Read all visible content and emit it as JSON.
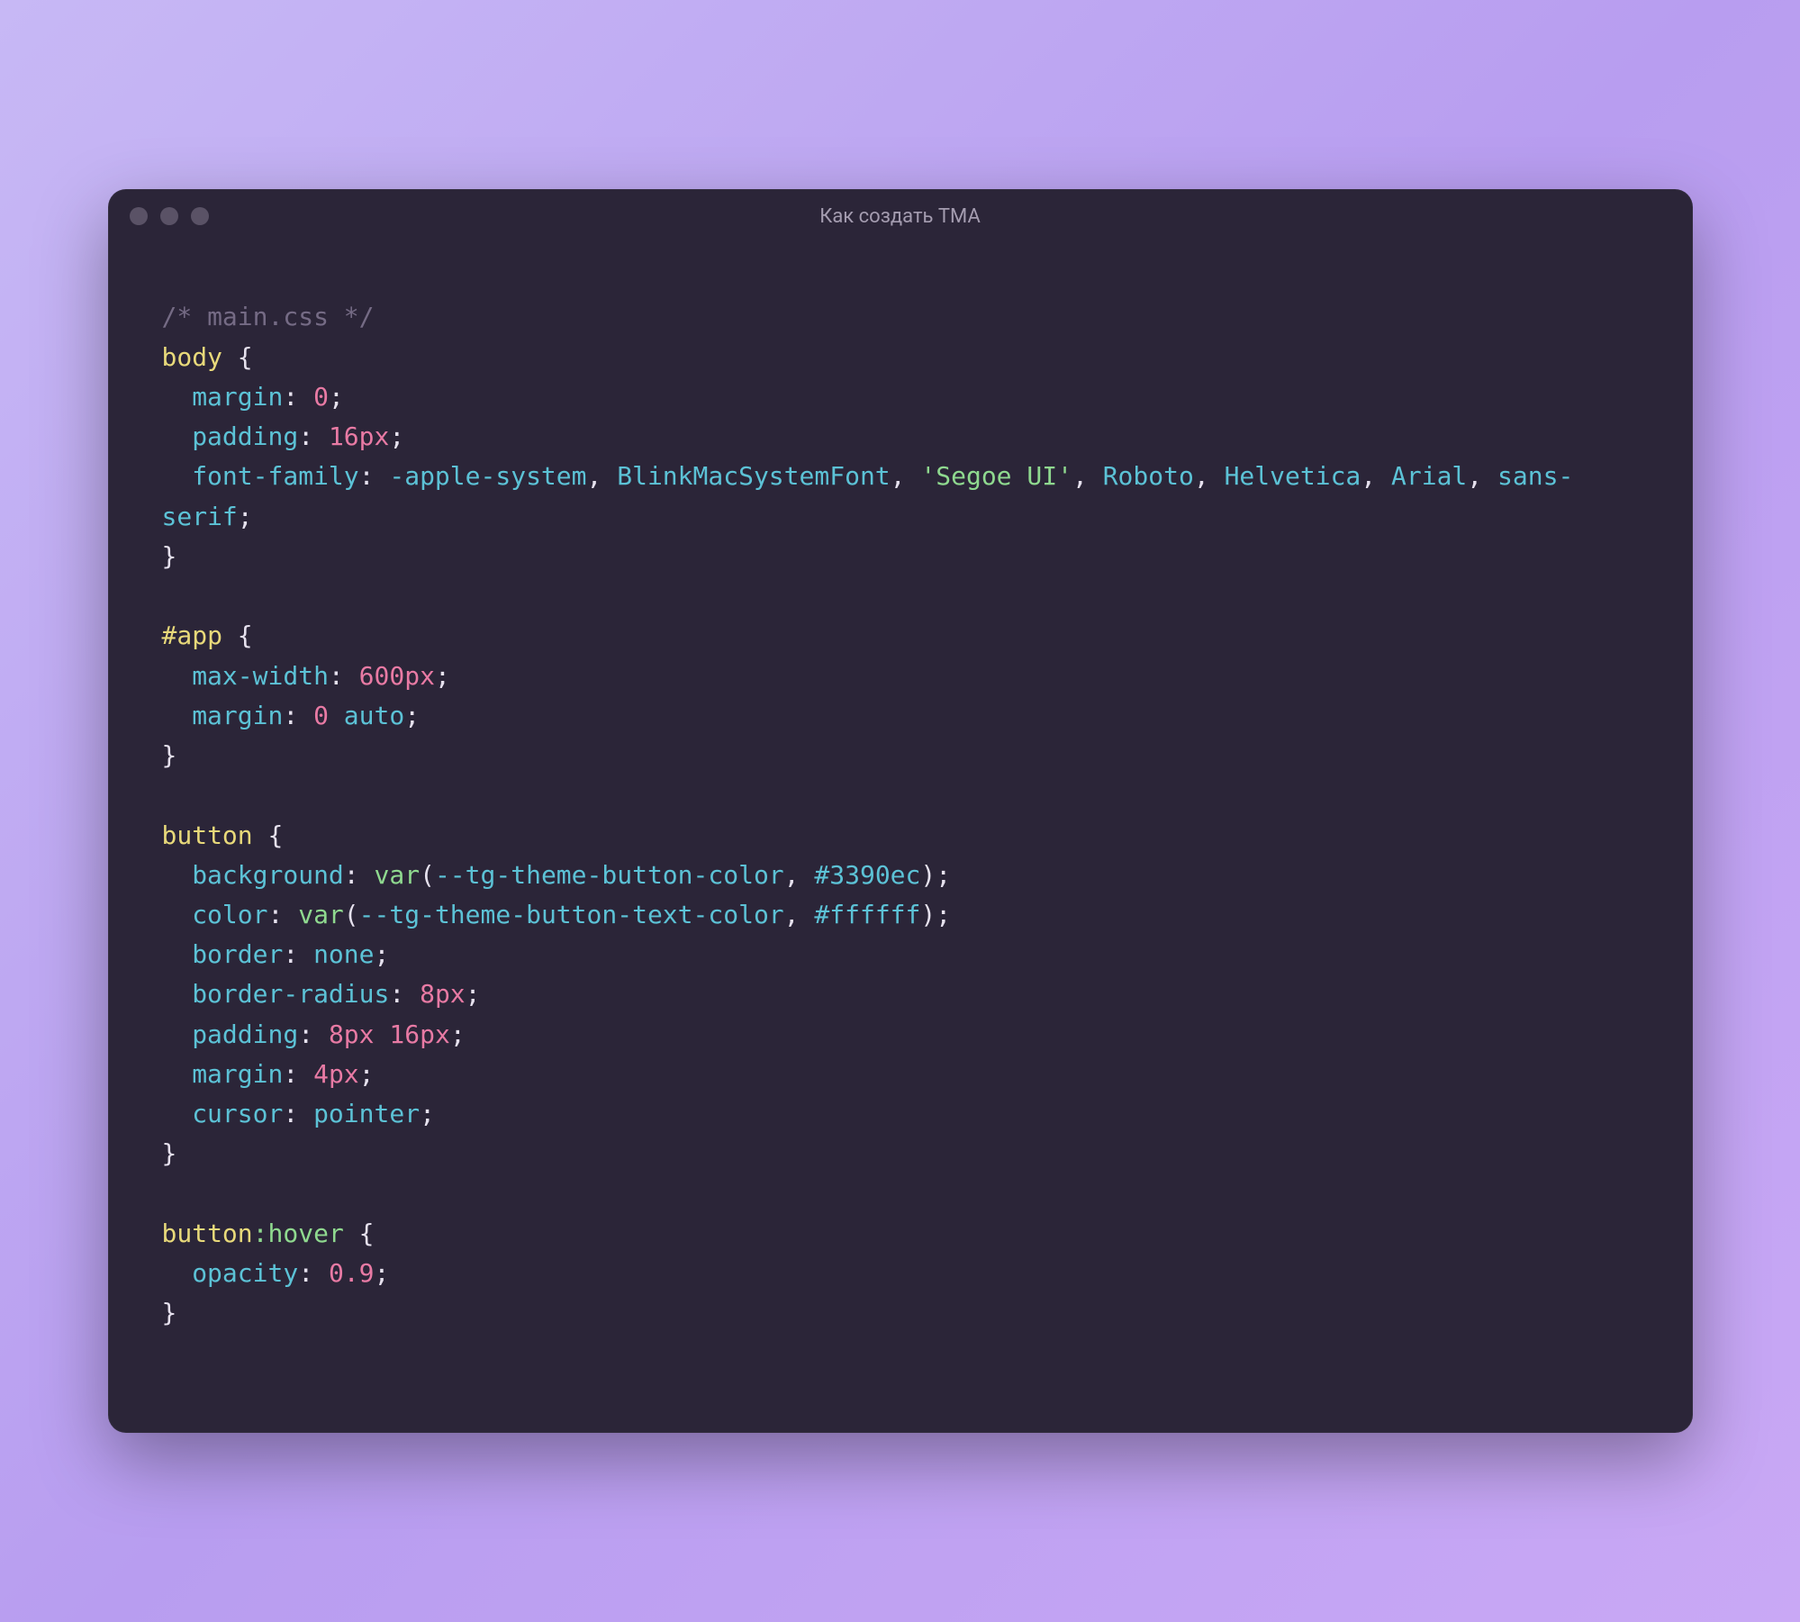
{
  "window": {
    "title": "Как создать TMA"
  },
  "code": {
    "comment": "/* main.css */",
    "rules": [
      {
        "selector": "body",
        "pseudo": "",
        "decls": [
          {
            "prop": "margin",
            "parts": [
              {
                "t": "num",
                "v": "0"
              }
            ]
          },
          {
            "prop": "padding",
            "parts": [
              {
                "t": "num",
                "v": "16"
              },
              {
                "t": "unit",
                "v": "px"
              }
            ]
          },
          {
            "prop": "font-family",
            "parts": [
              {
                "t": "ident",
                "v": "-apple-system"
              },
              {
                "t": "punct",
                "v": ", "
              },
              {
                "t": "ident",
                "v": "BlinkMacSystemFont"
              },
              {
                "t": "punct",
                "v": ", "
              },
              {
                "t": "string",
                "v": "'Segoe UI'"
              },
              {
                "t": "punct",
                "v": ", "
              },
              {
                "t": "ident",
                "v": "Roboto"
              },
              {
                "t": "punct",
                "v": ", "
              },
              {
                "t": "ident",
                "v": "Helvetica"
              },
              {
                "t": "punct",
                "v": ", "
              },
              {
                "t": "ident",
                "v": "Arial"
              },
              {
                "t": "punct",
                "v": ", "
              },
              {
                "t": "ident",
                "v": "sans-serif"
              }
            ]
          }
        ]
      },
      {
        "selector": "#app",
        "pseudo": "",
        "decls": [
          {
            "prop": "max-width",
            "parts": [
              {
                "t": "num",
                "v": "600"
              },
              {
                "t": "unit",
                "v": "px"
              }
            ]
          },
          {
            "prop": "margin",
            "parts": [
              {
                "t": "num",
                "v": "0"
              },
              {
                "t": "punct",
                "v": " "
              },
              {
                "t": "ident",
                "v": "auto"
              }
            ]
          }
        ]
      },
      {
        "selector": "button",
        "pseudo": "",
        "decls": [
          {
            "prop": "background",
            "parts": [
              {
                "t": "func",
                "v": "var"
              },
              {
                "t": "punct",
                "v": "("
              },
              {
                "t": "ident",
                "v": "--tg-theme-button-color"
              },
              {
                "t": "punct",
                "v": ", "
              },
              {
                "t": "ident",
                "v": "#3390ec"
              },
              {
                "t": "punct",
                "v": ")"
              }
            ]
          },
          {
            "prop": "color",
            "parts": [
              {
                "t": "func",
                "v": "var"
              },
              {
                "t": "punct",
                "v": "("
              },
              {
                "t": "ident",
                "v": "--tg-theme-button-text-color"
              },
              {
                "t": "punct",
                "v": ", "
              },
              {
                "t": "ident",
                "v": "#ffffff"
              },
              {
                "t": "punct",
                "v": ")"
              }
            ]
          },
          {
            "prop": "border",
            "parts": [
              {
                "t": "ident",
                "v": "none"
              }
            ]
          },
          {
            "prop": "border-radius",
            "parts": [
              {
                "t": "num",
                "v": "8"
              },
              {
                "t": "unit",
                "v": "px"
              }
            ]
          },
          {
            "prop": "padding",
            "parts": [
              {
                "t": "num",
                "v": "8"
              },
              {
                "t": "unit",
                "v": "px"
              },
              {
                "t": "punct",
                "v": " "
              },
              {
                "t": "num",
                "v": "16"
              },
              {
                "t": "unit",
                "v": "px"
              }
            ]
          },
          {
            "prop": "margin",
            "parts": [
              {
                "t": "num",
                "v": "4"
              },
              {
                "t": "unit",
                "v": "px"
              }
            ]
          },
          {
            "prop": "cursor",
            "parts": [
              {
                "t": "ident",
                "v": "pointer"
              }
            ]
          }
        ]
      },
      {
        "selector": "button",
        "pseudo": ":hover",
        "decls": [
          {
            "prop": "opacity",
            "parts": [
              {
                "t": "num",
                "v": "0.9"
              }
            ]
          }
        ]
      }
    ]
  }
}
